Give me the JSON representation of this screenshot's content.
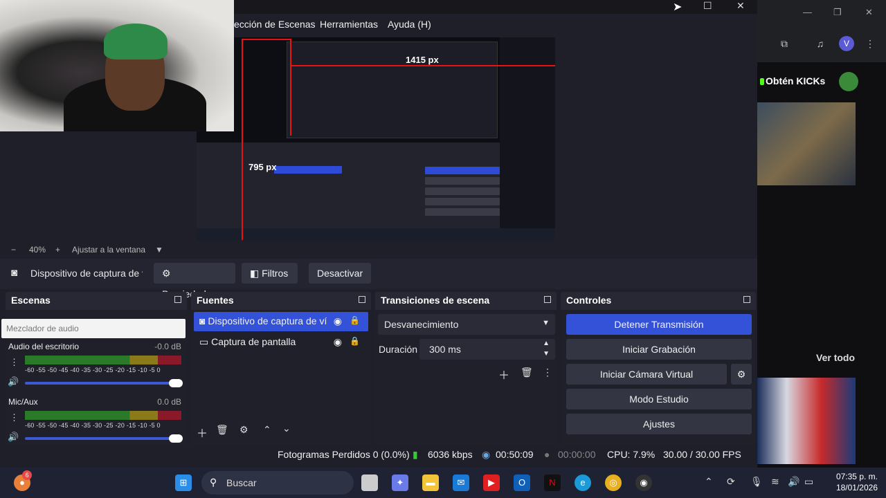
{
  "browser": {
    "kicks_label": "Obtén KICKs",
    "ver_todo": "Ver todo",
    "avatar_letter": "V"
  },
  "obs": {
    "menu": [
      "ección de Escenas",
      "Herramientas",
      "Ayuda (H)"
    ],
    "canvas_labels": {
      "width_px": "1415 px",
      "height_px": "795 px"
    },
    "zoom": {
      "minus": "−",
      "value": "40%",
      "plus": "+",
      "fit": "Ajustar a la ventana"
    },
    "context": {
      "source_name": "Dispositivo de captura de v",
      "properties": "Propiedades",
      "filters": "Filtros",
      "deactivate": "Desactivar"
    },
    "scenes": {
      "title": "Escenas"
    },
    "mixer": {
      "popup": "Mezclador de audio",
      "channels": [
        {
          "name": "Audio del escritorio",
          "db": "-0.0 dB"
        },
        {
          "name": "Mic/Aux",
          "db": "0.0 dB"
        }
      ],
      "scale": "-60 -55 -50 -45 -40 -35 -30 -25 -20 -15 -10 -5 0"
    },
    "sources": {
      "title": "Fuentes",
      "items": [
        {
          "label": "Dispositivo de captura de víc",
          "selected": true
        },
        {
          "label": "Captura de pantalla",
          "selected": false
        }
      ]
    },
    "transitions": {
      "title": "Transiciones de escena",
      "selected": "Desvanecimiento",
      "duration_label": "Duración",
      "duration_value": "300 ms"
    },
    "controls": {
      "title": "Controles",
      "stop_stream": "Detener Transmisión",
      "start_recording": "Iniciar Grabación",
      "virtual_camera": "Iniciar Cámara Virtual",
      "studio_mode": "Modo Estudio",
      "settings": "Ajustes"
    },
    "status": {
      "dropped": "Fotogramas Perdidos 0 (0.0%)",
      "bitrate": "6036 kbps",
      "stream_time": "00:50:09",
      "rec_time": "00:00:00",
      "cpu": "CPU: 7.9%",
      "fps": "30.00 / 30.00 FPS"
    }
  },
  "taskbar": {
    "search": "Buscar",
    "badge": "6",
    "time": "07:35 p. m.",
    "date": "18/01/2026"
  },
  "colors": {
    "accent": "#3352d8",
    "obs_bg": "#1e1f29",
    "red_guide": "#ee1111"
  }
}
